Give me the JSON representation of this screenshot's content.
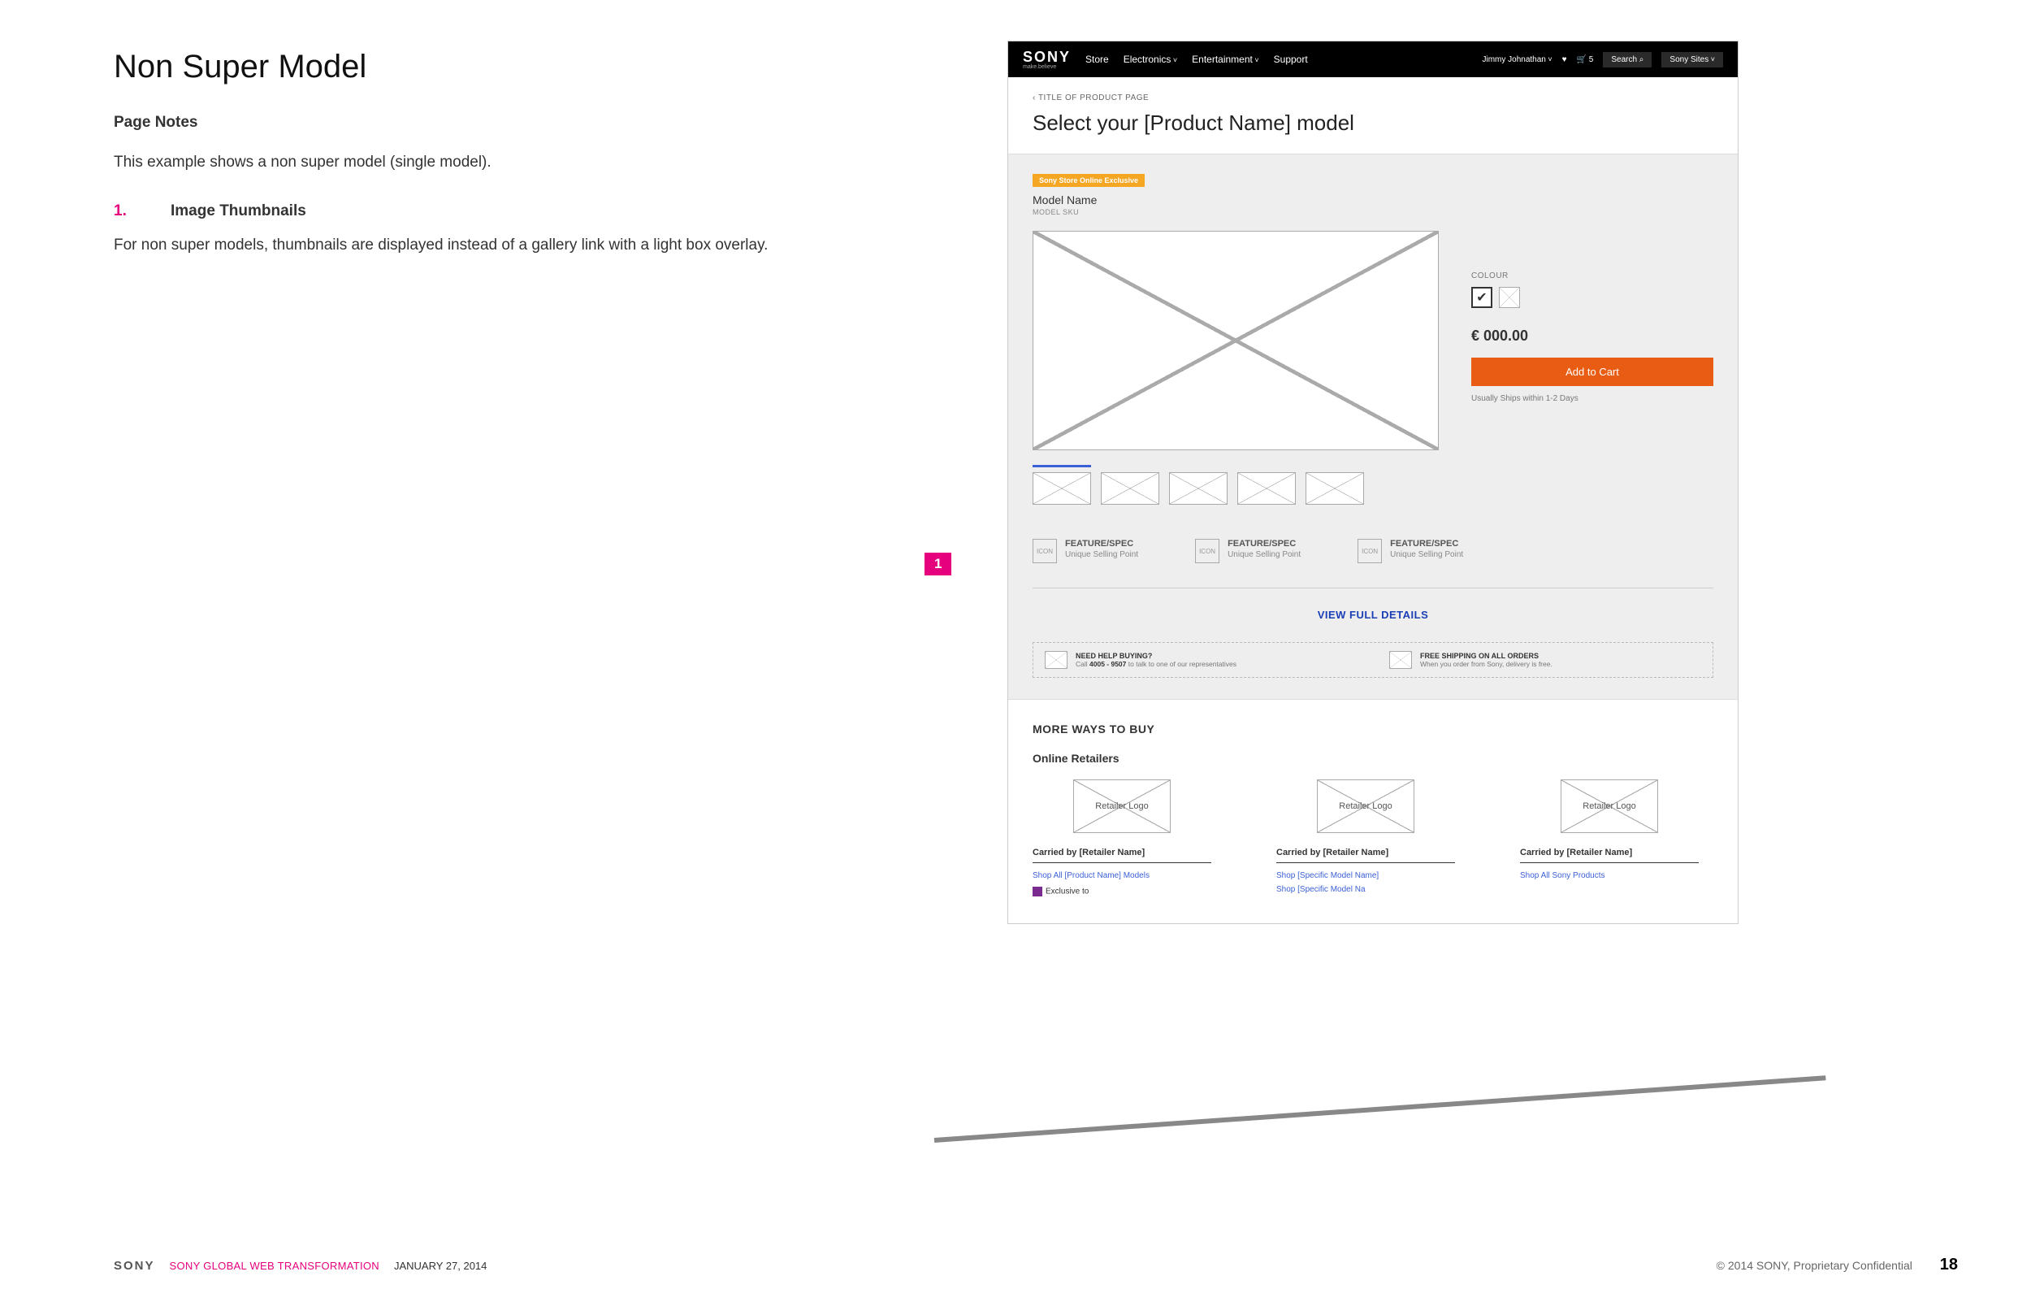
{
  "notes": {
    "title": "Non Super Model",
    "subtitle": "Page Notes",
    "intro": "This example shows a non super model (single model).",
    "item_num": "1.",
    "item_label": "Image Thumbnails",
    "item_body": "For non super models, thumbnails are displayed instead of a gallery link with a light box overlay."
  },
  "callout1": "1",
  "header": {
    "logo": "SONY",
    "tagline": "make.believe",
    "nav": {
      "store": "Store",
      "electronics": "Electronics",
      "entertainment": "Entertainment",
      "support": "Support"
    },
    "user": "Jimmy Johnathan",
    "cart": "🛒 5",
    "search": "Search",
    "sites": "Sony Sites"
  },
  "page": {
    "breadcrumb": "TITLE OF PRODUCT PAGE",
    "title": "Select your [Product Name] model"
  },
  "product": {
    "exclusive": "Sony Store Online Exclusive",
    "model_name": "Model Name",
    "model_sku": "MODEL SKU",
    "colour_label": "COLOUR",
    "swatch_check": "✔",
    "price": "€ 000.00",
    "add_to_cart": "Add to Cart",
    "ship": "Usually Ships within 1-2 Days"
  },
  "specs": {
    "icon_text": "ICON",
    "title": "FEATURE/SPEC",
    "sub": "Unique Selling Point"
  },
  "view_details": "VIEW FULL DETAILS",
  "help": {
    "h1": "NEED HELP BUYING?",
    "s1a": "Call ",
    "s1b": "4005 - 9507",
    "s1c": " to talk to one of our representatives",
    "h2": "FREE SHIPPING ON ALL ORDERS",
    "s2": "When you order from Sony, delivery is free."
  },
  "more_ways": {
    "title": "MORE WAYS TO BUY",
    "sub": "Online Retailers",
    "logo_text": "Retailer Logo",
    "carried": "Carried by [Retailer Name]",
    "r1_link1": "Shop All [Product Name] Models",
    "r1_excl": "Exclusive to",
    "r2_link1": "Shop [Specific Model Name]",
    "r2_link2": "Shop [Specific Model Na",
    "r3_link1": "Shop All Sony Products"
  },
  "footer": {
    "brand": "SONY",
    "project": "SONY GLOBAL WEB TRANSFORMATION",
    "date": "JANUARY 27, 2014",
    "copyright": "© 2014 SONY, Proprietary  Confidential",
    "page": "18"
  }
}
